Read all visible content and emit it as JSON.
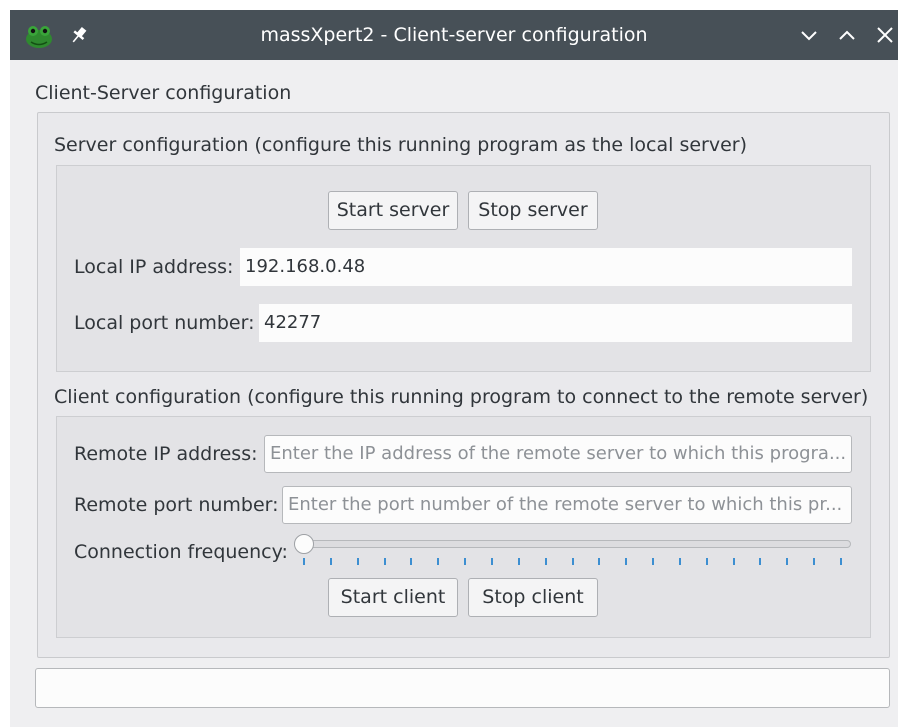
{
  "window": {
    "title": "massXpert2 - Client-server configuration"
  },
  "main": {
    "group_title": "Client-Server configuration"
  },
  "server": {
    "title": "Server configuration (configure this running program as the local server)",
    "start_label": "Start server",
    "stop_label": "Stop server",
    "ip_label": "Local IP address:",
    "ip_value": "192.168.0.48",
    "port_label": "Local port number:",
    "port_value": "42277"
  },
  "client": {
    "title": "Client configuration (configure this running program to connect to the remote server)",
    "remote_ip_label": "Remote IP address:",
    "remote_ip_placeholder": "Enter the IP address of the remote server to which this progra...",
    "remote_port_label": "Remote port number:",
    "remote_port_placeholder": "Enter the port number of the remote server to which this pr...",
    "frequency_label": "Connection frequency:",
    "frequency_value": 0,
    "start_label": "Start client",
    "stop_label": "Stop client"
  },
  "status": {
    "text": ""
  },
  "icons": {
    "app": "frog-icon",
    "pin": "pin-icon",
    "minimize": "chevron-down-icon",
    "maximize": "chevron-up-icon",
    "close": "close-icon"
  },
  "colors": {
    "titlebar": "#475057",
    "window_bg": "#efeff1",
    "tick_accent": "#3d8fd1"
  }
}
